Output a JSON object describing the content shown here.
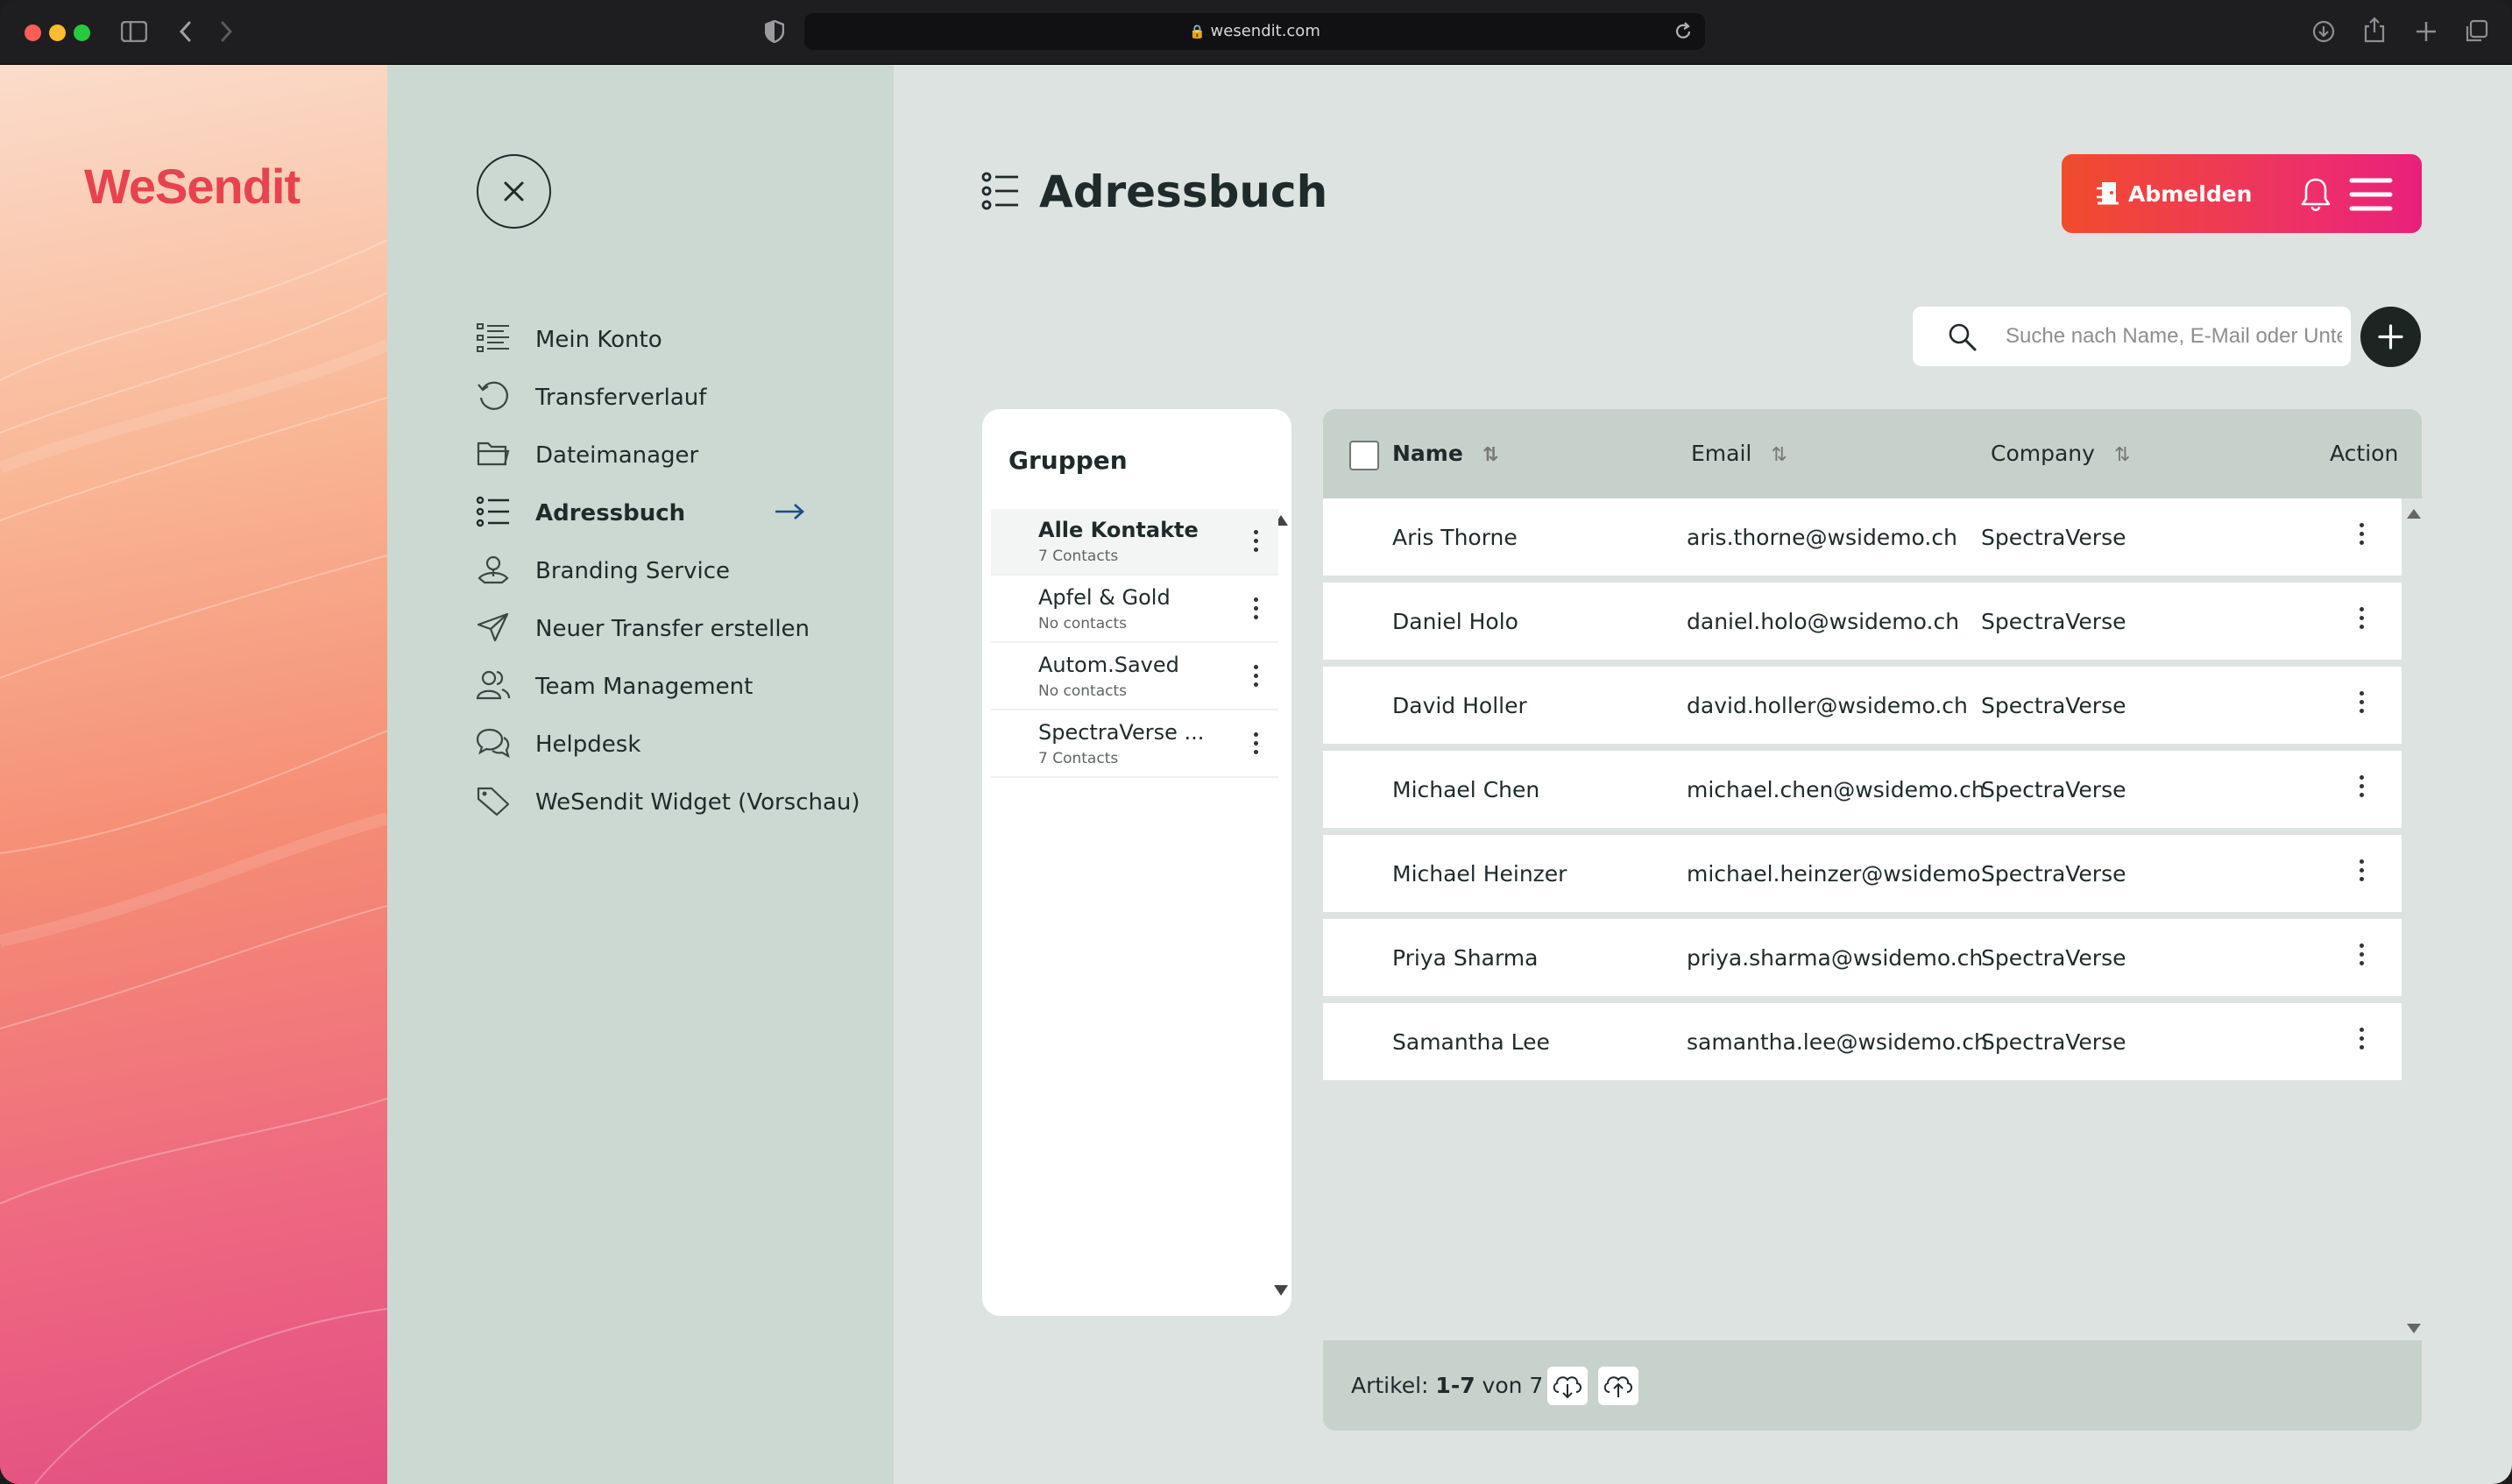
{
  "browser": {
    "url": "wesendit.com",
    "icons": [
      "sidebar-icon",
      "back-icon",
      "forward-icon",
      "shield-icon",
      "lock-icon",
      "reload-icon",
      "download-icon",
      "share-icon",
      "new-tab-icon",
      "tabs-icon"
    ]
  },
  "brand": {
    "logo": "WeSendit",
    "accent": "#e8424e"
  },
  "nav": {
    "items": [
      {
        "label": "Mein Konto",
        "icon": "list-icon"
      },
      {
        "label": "Transferverlauf",
        "icon": "history-icon"
      },
      {
        "label": "Dateimanager",
        "icon": "folder-icon"
      },
      {
        "label": "Adressbuch",
        "icon": "address-list-icon",
        "active": true
      },
      {
        "label": "Branding Service",
        "icon": "branding-icon"
      },
      {
        "label": "Neuer Transfer erstellen",
        "icon": "send-icon"
      },
      {
        "label": "Team Management",
        "icon": "team-icon"
      },
      {
        "label": "Helpdesk",
        "icon": "chat-icon"
      },
      {
        "label": "WeSendit Widget (Vorschau)",
        "icon": "tag-icon"
      }
    ]
  },
  "header": {
    "title": "Adressbuch",
    "logout_label": "Abmelden",
    "button_gradient": [
      "#f04c2c",
      "#e9207a"
    ]
  },
  "search": {
    "placeholder": "Suche nach Name, E-Mail oder Unte"
  },
  "groups": {
    "title": "Gruppen",
    "items": [
      {
        "name": "Alle Kontakte",
        "count": "7 Contacts",
        "selected": true
      },
      {
        "name": "Apfel & Gold",
        "count": "No contacts"
      },
      {
        "name": "Autom.Saved",
        "count": "No contacts"
      },
      {
        "name": "SpectraVerse ...",
        "count": "7 Contacts"
      }
    ]
  },
  "table": {
    "columns": {
      "name": "Name",
      "email": "Email",
      "company": "Company",
      "action": "Action"
    },
    "rows": [
      {
        "name": "Aris Thorne",
        "email": "aris.thorne@wsidemo.ch",
        "company": "SpectraVerse"
      },
      {
        "name": "Daniel Holo",
        "email": "daniel.holo@wsidemo.ch",
        "company": "SpectraVerse"
      },
      {
        "name": "David Holler",
        "email": "david.holler@wsidemo.ch",
        "company": "SpectraVerse"
      },
      {
        "name": "Michael Chen",
        "email": "michael.chen@wsidemo.ch",
        "company": "SpectraVerse"
      },
      {
        "name": "Michael Heinzer",
        "email": "michael.heinzer@wsidemo....",
        "company": "SpectraVerse"
      },
      {
        "name": "Priya Sharma",
        "email": "priya.sharma@wsidemo.ch",
        "company": "SpectraVerse"
      },
      {
        "name": "Samantha Lee",
        "email": "samantha.lee@wsidemo.ch",
        "company": "SpectraVerse"
      }
    ]
  },
  "footer": {
    "prefix": "Artikel:",
    "range": "1-7",
    "suffix": "von 7"
  }
}
